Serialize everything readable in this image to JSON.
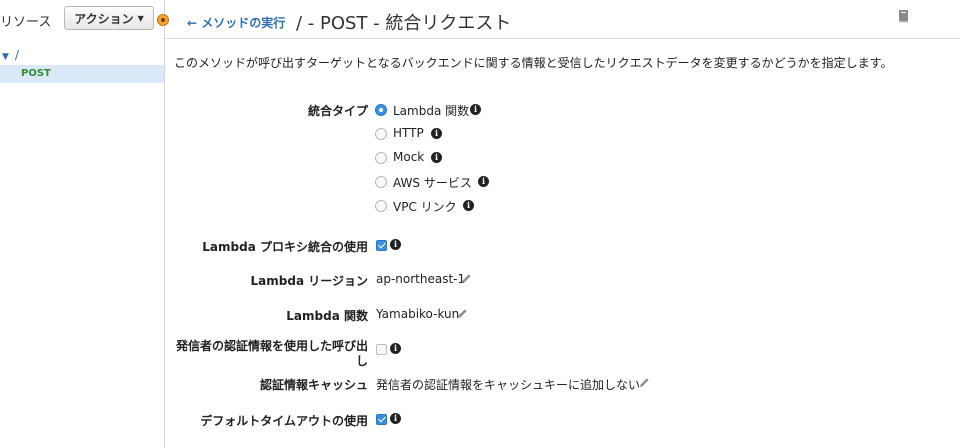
{
  "sidebar": {
    "title": "リソース",
    "actions_label": "アクション",
    "tree": {
      "root": "/",
      "child": "POST"
    }
  },
  "header": {
    "back_label": "メソッドの実行",
    "title": "/ - POST - 統合リクエスト"
  },
  "description": "このメソッドが呼び出すターゲットとなるバックエンドに関する情報と受信したリクエストデータを変更するかどうかを指定します。",
  "integration": {
    "type_label": "統合タイプ",
    "options": [
      {
        "label": "Lambda 関数",
        "checked": true
      },
      {
        "label": "HTTP",
        "checked": false
      },
      {
        "label": "Mock",
        "checked": false
      },
      {
        "label": "AWS サービス",
        "checked": false
      },
      {
        "label": "VPC リンク",
        "checked": false
      }
    ]
  },
  "settings": {
    "proxy_label": "Lambda プロキシ統合の使用",
    "proxy_checked": true,
    "region_label": "Lambda リージョン",
    "region_value": "ap-northeast-1",
    "function_label": "Lambda 関数",
    "function_value": "Yamabiko-kun",
    "caller_cred_label_line1": "発信者の認証情報を使用した呼び出",
    "caller_cred_label_line2": "し",
    "caller_cred_checked": false,
    "cred_cache_label": "認証情報キャッシュ",
    "cred_cache_value": "発信者の認証情報をキャッシュキーに追加しない",
    "timeout_label": "デフォルトタイムアウトの使用",
    "timeout_checked": true
  },
  "colors": {
    "link": "#2a6fb8",
    "accent": "#3b8fe0",
    "selected_row": "#dbe8f7",
    "post_text": "#2f8f2f",
    "action_indicator": "#f7a535"
  }
}
